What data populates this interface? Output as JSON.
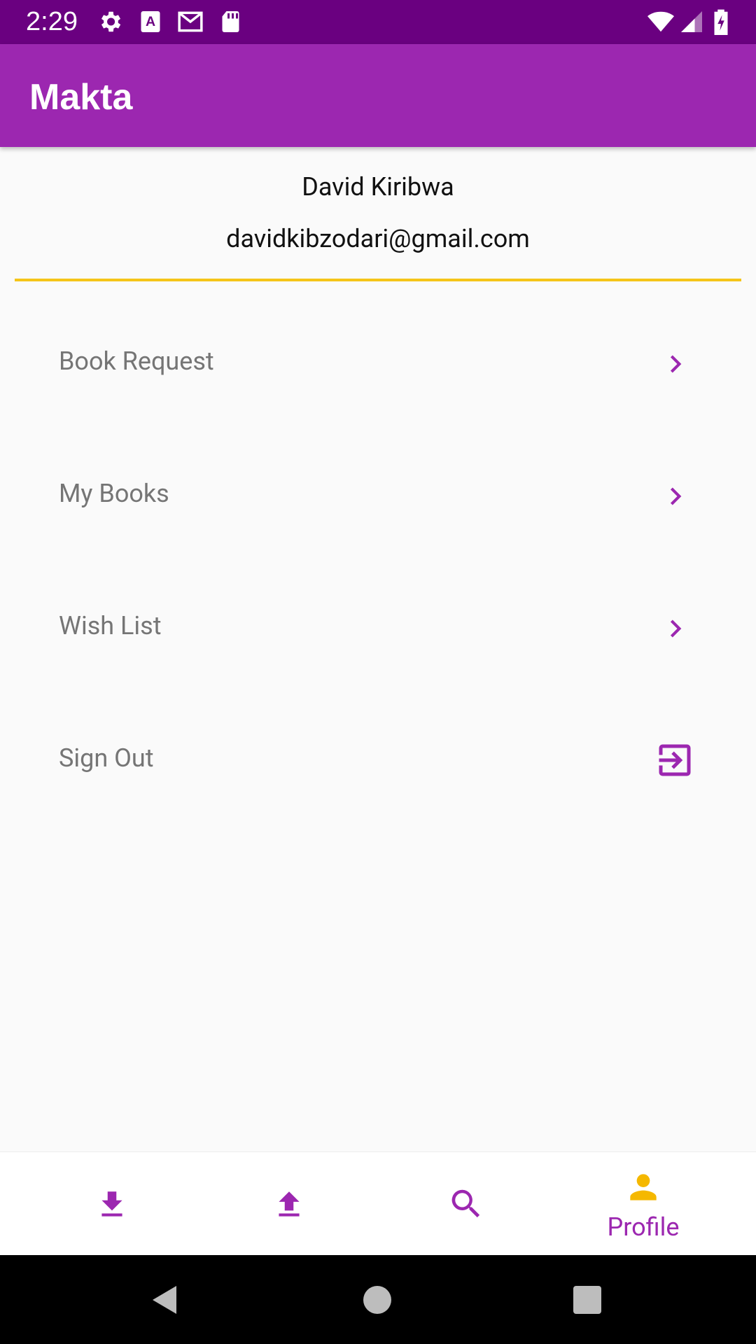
{
  "status_bar": {
    "time": "2:29",
    "icons": [
      "settings-icon",
      "keyboard-a-icon",
      "gmail-icon",
      "sd-card-icon",
      "wifi-icon",
      "signal-icon",
      "battery-charging-icon"
    ]
  },
  "app_bar": {
    "title": "Makta"
  },
  "profile": {
    "name": "David Kiribwa",
    "email": "davidkibzodari@gmail.com"
  },
  "menu": [
    {
      "label": "Book Request",
      "icon": "chevron-right-icon"
    },
    {
      "label": "My Books",
      "icon": "chevron-right-icon"
    },
    {
      "label": "Wish List",
      "icon": "chevron-right-icon"
    },
    {
      "label": "Sign Out",
      "icon": "exit-to-app-icon"
    }
  ],
  "bottom_nav": [
    {
      "icon": "download-icon",
      "label": ""
    },
    {
      "icon": "upload-icon",
      "label": ""
    },
    {
      "icon": "search-icon",
      "label": ""
    },
    {
      "icon": "person-icon",
      "label": "Profile",
      "active": true
    }
  ],
  "colors": {
    "primary": "#9c27b0",
    "primary_dark": "#6a0080",
    "accent": "#f5c518"
  }
}
